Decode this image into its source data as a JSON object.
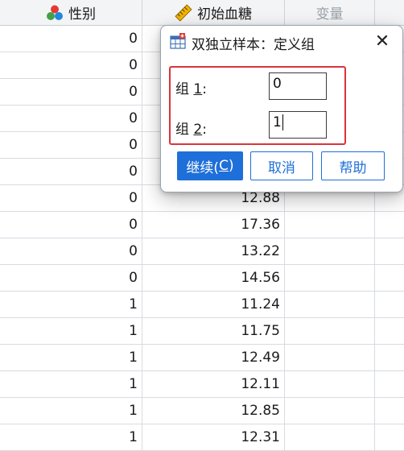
{
  "columns": [
    {
      "name": "性别",
      "icon": "nominal-variable-icon",
      "muted": false
    },
    {
      "name": "初始血糖",
      "icon": "scale-variable-icon",
      "muted": false
    },
    {
      "name": "变量",
      "muted": true
    }
  ],
  "rows": [
    {
      "gender": "0",
      "glucose": ""
    },
    {
      "gender": "0",
      "glucose": ""
    },
    {
      "gender": "0",
      "glucose": ""
    },
    {
      "gender": "0",
      "glucose": ""
    },
    {
      "gender": "0",
      "glucose": ""
    },
    {
      "gender": "0",
      "glucose": ""
    },
    {
      "gender": "0",
      "glucose": "12.88"
    },
    {
      "gender": "0",
      "glucose": "17.36"
    },
    {
      "gender": "0",
      "glucose": "13.22"
    },
    {
      "gender": "0",
      "glucose": "14.56"
    },
    {
      "gender": "1",
      "glucose": "11.24"
    },
    {
      "gender": "1",
      "glucose": "11.75"
    },
    {
      "gender": "1",
      "glucose": "12.49"
    },
    {
      "gender": "1",
      "glucose": "12.11"
    },
    {
      "gender": "1",
      "glucose": "12.85"
    },
    {
      "gender": "1",
      "glucose": "12.31"
    }
  ],
  "dialog": {
    "title": "双独立样本：定义组",
    "title_icon": "define-groups-icon",
    "close_label": "✕",
    "group1": {
      "label_prefix": "组 ",
      "label_key": "1",
      "label_suffix": ":",
      "value": "0"
    },
    "group2": {
      "label_prefix": "组 ",
      "label_key": "2",
      "label_suffix": ":",
      "value": "1"
    },
    "buttons": {
      "continue": {
        "text": "继续(",
        "key": "C",
        "suffix": ")"
      },
      "cancel": "取消",
      "help": "帮助"
    }
  },
  "colors": {
    "accent": "#1e6fd9",
    "highlight_border": "#d9343b"
  }
}
